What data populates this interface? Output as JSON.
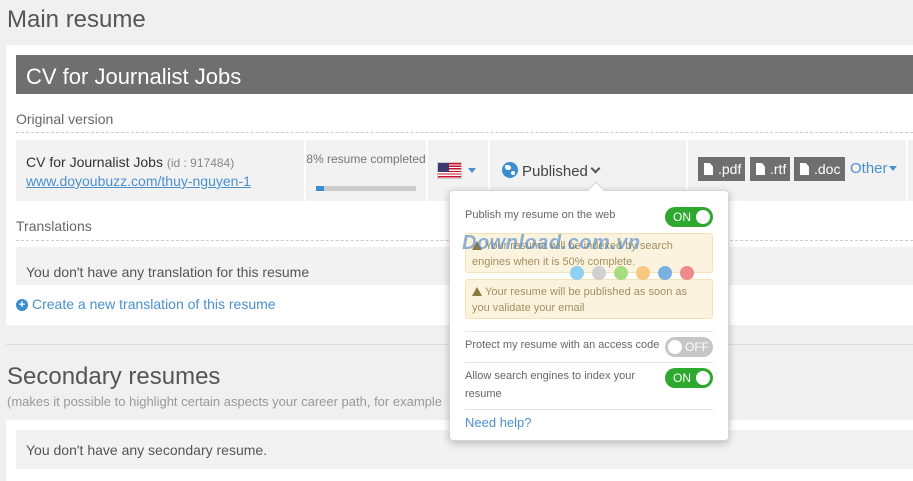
{
  "page": {
    "title": "Main resume"
  },
  "main": {
    "cv_title": "CV for Journalist Jobs",
    "original_label": "Original version",
    "cv_name": "CV for Journalist Jobs",
    "cv_id": "(id : 917484)",
    "cv_url": "www.doyoubuzz.com/thuy-nguyen-1",
    "progress": {
      "text": "8% resume completed",
      "percent": 8
    },
    "language_flag": "us-flag-icon",
    "status": "Published",
    "formats": [
      ".pdf",
      ".rtf",
      ".doc"
    ],
    "other_label": "Other",
    "translations_label": "Translations",
    "no_translation": "You don't have any translation for this resume",
    "create_translation": "Create a new translation of this resume"
  },
  "secondary": {
    "title": "Secondary resumes",
    "subtitle": "(makes it possible to highlight certain aspects your career path, for example",
    "empty": "You don't have any secondary resume."
  },
  "popover": {
    "publish_label": "Publish my resume on the web",
    "publish_toggle": "ON",
    "warning_indexed": "Your resume will be indexed by search engines when it is 50% complete.",
    "warning_email": "Your resume will be published as soon as you validate your email",
    "protect_label": "Protect my resume with an access code",
    "protect_toggle": "OFF",
    "index_label": "Allow search engines to index your resume",
    "index_toggle": "ON",
    "help": "Need help?"
  },
  "watermark": {
    "text": "Download.com.vn"
  },
  "colors": {
    "accent": "#4a90d0",
    "banner": "#6f6f6f",
    "toggle_on": "#2ea82e",
    "toggle_off": "#c6c6c6",
    "warning_bg": "#fcf3de",
    "dots": [
      "#8fd0f0",
      "#d0d0d0",
      "#a8dc80",
      "#f8c880",
      "#7ab0e0",
      "#f08a8a"
    ]
  }
}
